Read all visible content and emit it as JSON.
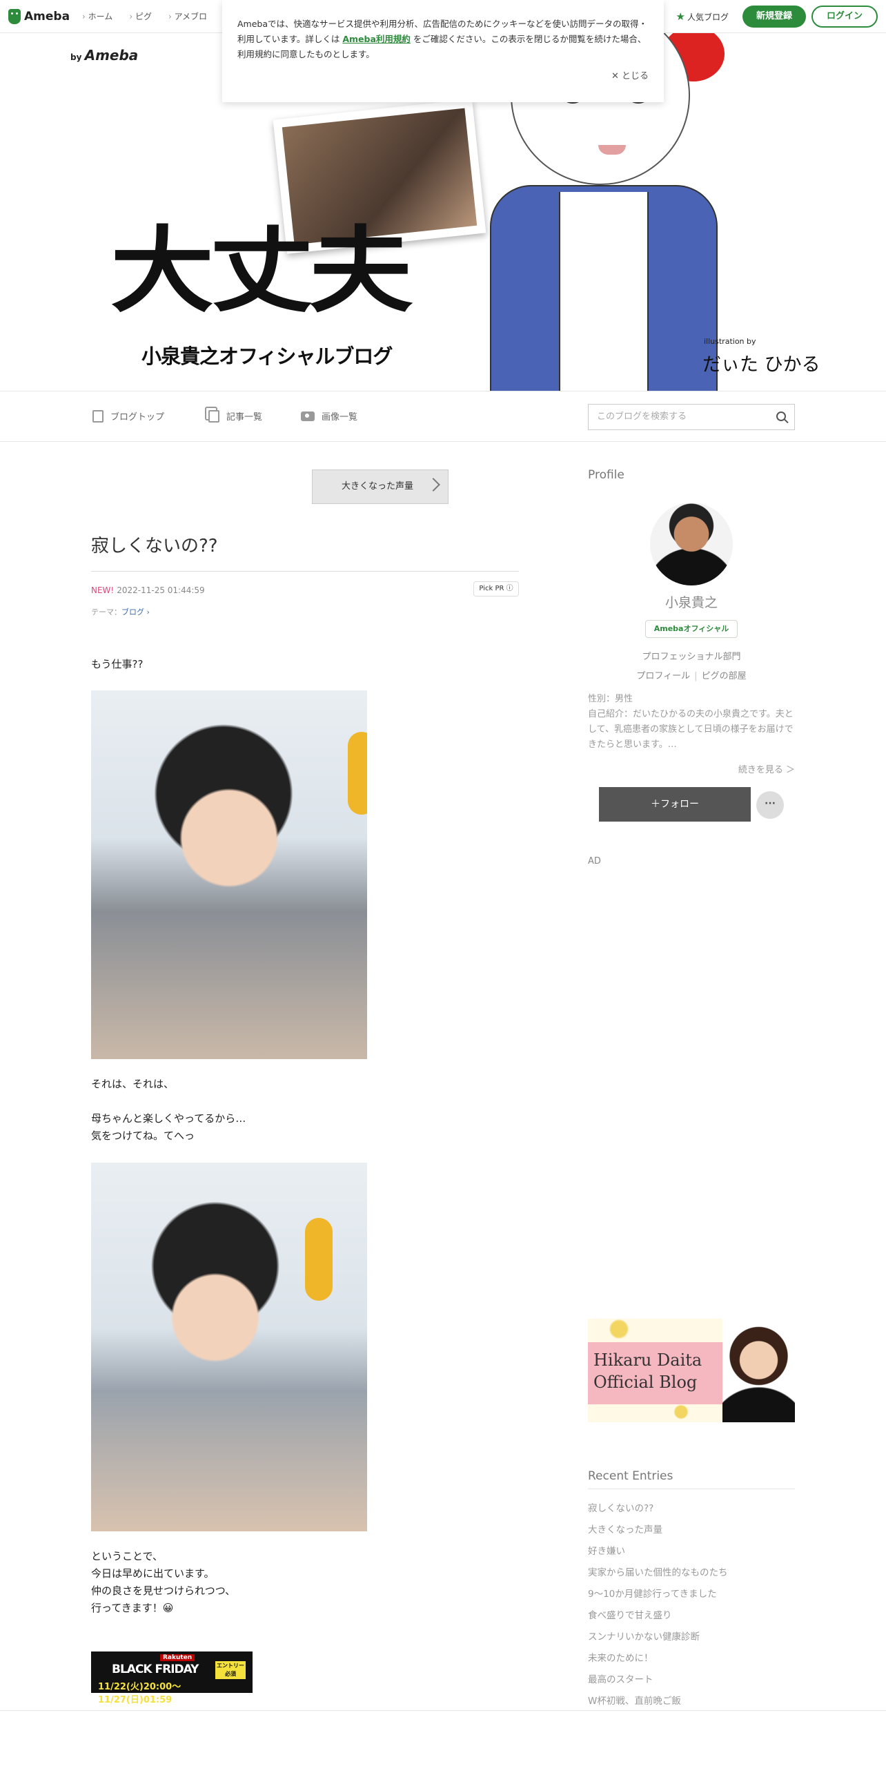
{
  "topbar": {
    "logo": "Ameba",
    "nav": [
      "ホーム",
      "ピグ",
      "アメブロ"
    ],
    "popular": "人気ブログ",
    "register": "新規登録",
    "login": "ログイン"
  },
  "cookie": {
    "text_before": "Amebaでは、快適なサービス提供や利用分析、広告配信のためにクッキーなどを使い訪問データの取得・利用しています。詳しくは ",
    "link": "Ameba利用規約",
    "text_after": " をご確認ください。この表示を閉じるか閲覧を続けた場合、利用規約に同意したものとします。",
    "close": "✕ とじる"
  },
  "header": {
    "by": "by",
    "by_brand": "Ameba",
    "title": "大丈夫",
    "subtitle": "小泉貴之オフィシャルブログ",
    "illus_by": "illustration by",
    "signature": "だぃた ひかる"
  },
  "blognav": {
    "items": [
      "ブログトップ",
      "記事一覧",
      "画像一覧"
    ],
    "search_placeholder": "このブログを検索する"
  },
  "post": {
    "prev_label": "大きくなった声量",
    "title": "寂しくないの??",
    "new": "NEW!",
    "datetime": "2022-11-25 01:44:59",
    "pickpr": "Pick PR ⓘ",
    "theme_label": "テーマ：",
    "theme": "ブログ ›",
    "text1": "もう仕事??",
    "text2": "それは、それは、\n\n母ちゃんと楽しくやってるから…\n気をつけてね。てへっ",
    "text3": "ということで、\n今日は早めに出ています。\n仲の良さを見せつけられつつ、\n行ってきます！😀",
    "banner": {
      "brand": "Rakuten",
      "title": "BLACK FRIDAY",
      "dates": "11/22(火)20:00～11/27(日)01:59",
      "entry": "エントリー\n必須"
    }
  },
  "side": {
    "profile_h": "Profile",
    "name": "小泉貴之",
    "official": "Amebaオフィシャル",
    "pro": "プロフェッショナル部門",
    "link1": "プロフィール",
    "link2": "ピグの部屋",
    "info": "性別：男性\n自己紹介：だいたひかるの夫の小泉貴之です。夫として、乳癌患者の家族として日頃の様子をお届けできたらと思います。…",
    "more": "続きを見る ＞",
    "follow": "＋フォロー",
    "follow_more": "···",
    "ad": "AD",
    "hikaru_title": "Hikaru Daita\nOfficial Blog",
    "recent_h": "Recent Entries",
    "recent": [
      "寂しくないの??",
      "大きくなった声量",
      "好き嫌い",
      "実家から届いた個性的なものたち",
      "9～10か月健診行ってきました",
      "食べ盛りで甘え盛り",
      "スンナリいかない健康診断",
      "未来のために！",
      "最高のスタート",
      "W杯初戦、直前晩ご飯"
    ]
  },
  "colors": {
    "accent": "#2d8c3c",
    "new": "#e0457b",
    "link": "#3c69b0"
  }
}
